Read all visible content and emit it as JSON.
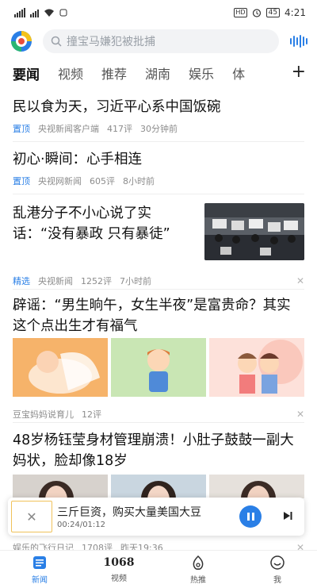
{
  "status_bar": {
    "time": "4:21",
    "battery": "45",
    "hd_label": "HD"
  },
  "search": {
    "placeholder": "撞宝马嫌犯被批捕"
  },
  "tabs": [
    {
      "label": "要闻"
    },
    {
      "label": "视频"
    },
    {
      "label": "推荐"
    },
    {
      "label": "湖南"
    },
    {
      "label": "娱乐"
    },
    {
      "label": "体"
    }
  ],
  "feed": [
    {
      "title": "民以食为天，习近平心系中国饭碗",
      "tag": "置顶",
      "source": "央视新闻客户端",
      "comments": "417评",
      "time": "30分钟前"
    },
    {
      "title": "初心·瞬间：心手相连",
      "tag": "置顶",
      "source": "央视网新闻",
      "comments": "605评",
      "time": "8小时前"
    },
    {
      "title": "乱港分子不小心说了实话：“没有暴政 只有暴徒”",
      "tag": "精选",
      "source": "央视新闻",
      "comments": "1252评",
      "time": "7小时前"
    },
    {
      "title": "辟谣：“男生晌午，女生半夜”是富贵命？其实这个点出生才有福气",
      "source": "豆宝妈妈说育儿",
      "comments": "12评"
    },
    {
      "title": "48岁杨钰莹身材管理崩溃！小肚子鼓鼓一副大妈状，脸却像18岁",
      "source": "娱乐的飞行日记",
      "comments": "1708评",
      "time": "昨天19:36"
    }
  ],
  "player": {
    "title": "三斤巨资，购买大量美国大豆",
    "time": "00:24/01:12"
  },
  "bottom_nav": [
    {
      "label": "新闻",
      "icon": "news-icon"
    },
    {
      "label": "视频",
      "icon": "video-1068-icon",
      "badge": "1068"
    },
    {
      "label": "热推",
      "icon": "hot-icon"
    },
    {
      "label": "我",
      "icon": "profile-icon"
    }
  ],
  "colors": {
    "accent": "#2a7fe6",
    "tag_blue": "#2a7fe6",
    "meta_gray": "#8c8c8c"
  }
}
